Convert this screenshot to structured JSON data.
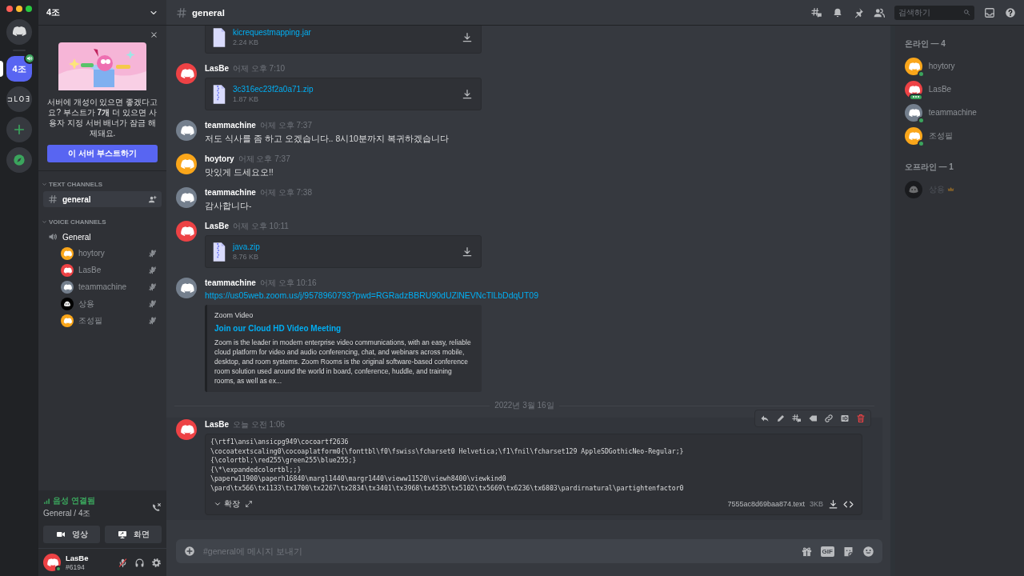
{
  "window": {
    "controls": [
      {
        "kind": "close"
      },
      {
        "kind": "minimize"
      },
      {
        "kind": "zoom"
      }
    ]
  },
  "servers": [
    {
      "kind": "home",
      "selected": false
    },
    {
      "kind": "server",
      "label": "4조",
      "selected": true,
      "in_voice": true
    },
    {
      "kind": "server",
      "label": "⊐LOƎ",
      "selected": false,
      "in_voice": false
    },
    {
      "kind": "add",
      "selected": false
    },
    {
      "kind": "explore",
      "selected": false
    }
  ],
  "sidebar": {
    "server_name": "4조",
    "boost": {
      "text": "서버에 개성이 있으면 좋겠다고요? 부스트가 **7개** 더 있으면 사용자 지정 서버 배너가 잠금 해제돼요.",
      "button": "이 서버 부스트하기"
    },
    "categories": [
      {
        "name": "TEXT CHANNELS",
        "expanded": true,
        "channels": [
          {
            "kind": "text",
            "name": "general",
            "selected": true
          }
        ]
      },
      {
        "name": "VOICE CHANNELS",
        "expanded": true,
        "channels": [
          {
            "kind": "voice",
            "name": "General",
            "selected": false,
            "users": [
              {
                "name": "hoytory",
                "avatar": {
                  "kind": "default",
                  "color": "#faa61a"
                },
                "muted": true
              },
              {
                "name": "LasBe",
                "avatar": {
                  "kind": "default",
                  "color": "#ed4245"
                },
                "muted": true
              },
              {
                "name": "teammachine",
                "avatar": {
                  "kind": "default",
                  "color": "#747f8d"
                },
                "muted": true
              },
              {
                "name": "상용",
                "avatar": {
                  "kind": "custom",
                  "color": "#000000"
                },
                "muted": true
              },
              {
                "name": "조성필",
                "avatar": {
                  "kind": "default",
                  "color": "#faa61a"
                },
                "muted": true
              }
            ]
          }
        ]
      }
    ],
    "voice_panel": {
      "status": "음성 연결됨",
      "location": "General / 4조",
      "buttons": [
        {
          "kind": "video",
          "label": "영상"
        },
        {
          "kind": "screen",
          "label": "화면"
        }
      ]
    },
    "user_panel": {
      "name": "LasBe",
      "tag": "#6194",
      "avatar": {
        "kind": "default",
        "color": "#ed4245"
      },
      "muted": true,
      "deafened": false
    }
  },
  "channel_header": {
    "name": "general",
    "search": {
      "placeholder": "검색하기"
    }
  },
  "messages": [
    {
      "kind": "file",
      "file": {
        "kind": "document",
        "name": "kicrequestmapping.jar",
        "size": "2.24 KB"
      }
    },
    {
      "kind": "file",
      "author": "LasBe",
      "avatar": {
        "kind": "default",
        "color": "#ed4245"
      },
      "time": "어제 오후 7:10",
      "file": {
        "kind": "archive",
        "name": "3c316ec23f2a0a71.zip",
        "size": "1.87 KB"
      }
    },
    {
      "kind": "text",
      "author": "teammachine",
      "avatar": {
        "kind": "default",
        "color": "#747f8d"
      },
      "time": "어제 오후 7:37",
      "text": "저도 식사를 좀 하고 오겠습니다.. 8시10분까지 복귀하겠습니다"
    },
    {
      "kind": "text",
      "author": "hoytory",
      "avatar": {
        "kind": "default",
        "color": "#faa61a"
      },
      "time": "어제 오후 7:37",
      "text": "맛있게 드세요오!!"
    },
    {
      "kind": "text",
      "author": "teammachine",
      "avatar": {
        "kind": "default",
        "color": "#747f8d"
      },
      "time": "어제 오후 7:38",
      "text": "감사합니다-"
    },
    {
      "kind": "file",
      "author": "LasBe",
      "avatar": {
        "kind": "default",
        "color": "#ed4245"
      },
      "time": "어제 오후 10:11",
      "file": {
        "kind": "archive",
        "name": "java.zip",
        "size": "8.76 KB"
      }
    },
    {
      "kind": "link",
      "author": "teammachine",
      "avatar": {
        "kind": "default",
        "color": "#747f8d"
      },
      "time": "어제 오후 10:16",
      "link": "https://us05web.zoom.us/j/9578960793?pwd=RGRadzBBRU90dUZlNEVNcTlLbDdqUT09",
      "embed": {
        "provider": "Zoom Video",
        "title": "Join our Cloud HD Video Meeting",
        "description": "Zoom is the leader in modern enterprise video communications, with an easy, reliable cloud platform for video and audio conferencing, chat, and webinars across mobile, desktop, and room systems. Zoom Rooms is the original software-based conference room solution used around the world in board, conference, huddle, and training rooms, as well as ex..."
      }
    },
    {
      "kind": "divider",
      "date": "2022년 3월 16일"
    },
    {
      "kind": "code",
      "author": "LasBe",
      "avatar": {
        "kind": "default",
        "color": "#ed4245"
      },
      "time": "오늘 오전 1:06",
      "hovered": true,
      "lines": [
        "{\\rtf1\\ansi\\ansicpg949\\cocoartf2636",
        "\\cocoatextscaling0\\cocoaplatform0{\\fonttbl\\f0\\fswiss\\fcharset0 Helvetica;\\f1\\fnil\\fcharset129 AppleSDGothicNeo-Regular;}",
        "{\\colortbl;\\red255\\green255\\blue255;}",
        "{\\*\\expandedcolortbl;;}",
        "\\paperw11900\\paperh16840\\margl1440\\margr1440\\vieww11520\\viewh8400\\viewkind0",
        "\\pard\\tx566\\tx1133\\tx1700\\tx2267\\tx2834\\tx3401\\tx3968\\tx4535\\tx5102\\tx5669\\tx6236\\tx6803\\pardirnatural\\partightenfactor0"
      ],
      "expand_label": "확장",
      "file_name": "7555ac8d69baa874.text",
      "file_size": "3KB"
    }
  ],
  "composer": {
    "placeholder": "#general에 메시지 보내기",
    "gif_label": "GIF"
  },
  "members": {
    "groups": [
      {
        "title": "온라인 — 4",
        "members": [
          {
            "name": "hoytory",
            "avatar": {
              "kind": "default",
              "color": "#faa61a"
            },
            "online": true,
            "typing": false,
            "owner": false
          },
          {
            "name": "LasBe",
            "avatar": {
              "kind": "default",
              "color": "#ed4245"
            },
            "online": true,
            "typing": true,
            "owner": false
          },
          {
            "name": "teammachine",
            "avatar": {
              "kind": "default",
              "color": "#747f8d"
            },
            "online": true,
            "typing": false,
            "owner": false
          },
          {
            "name": "조성필",
            "avatar": {
              "kind": "default",
              "color": "#faa61a"
            },
            "online": true,
            "typing": false,
            "owner": false
          }
        ]
      },
      {
        "title": "오프라인 — 1",
        "members": [
          {
            "name": "상용",
            "avatar": {
              "kind": "custom",
              "color": "#1a1b1e"
            },
            "online": false,
            "typing": false,
            "owner": true
          }
        ]
      }
    ]
  }
}
